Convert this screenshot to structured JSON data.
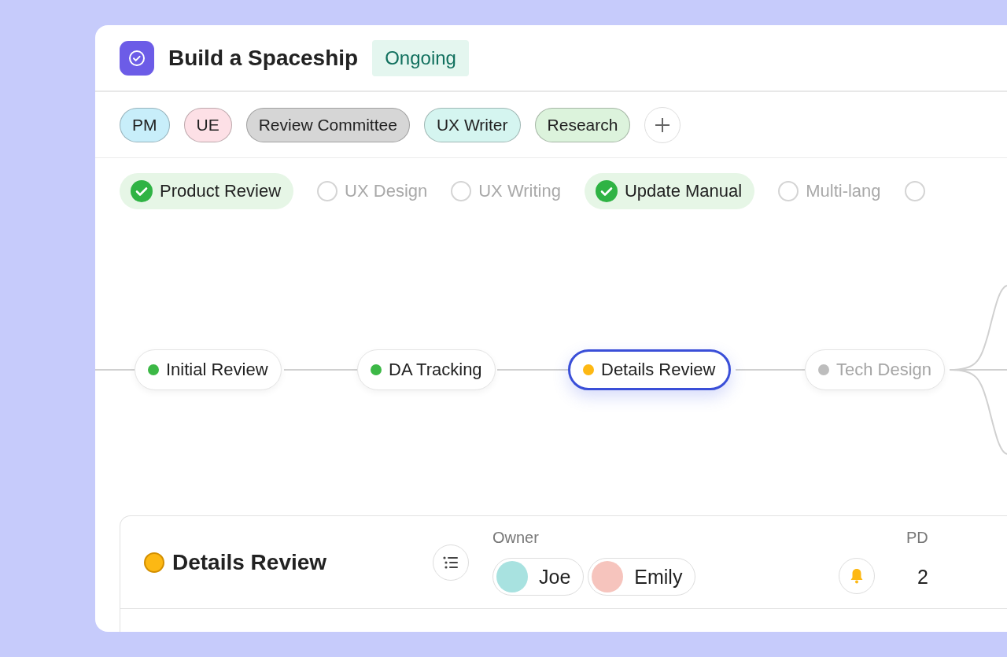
{
  "project": {
    "title": "Build a Spaceship",
    "status": "Ongoing"
  },
  "roles": [
    {
      "label": "PM",
      "color": "#c8eefa"
    },
    {
      "label": "UE",
      "color": "#fde0e6"
    },
    {
      "label": "Review Committee",
      "color": "#d6d6d6"
    },
    {
      "label": "UX Writer",
      "color": "#d5f5f0"
    },
    {
      "label": "Research",
      "color": "#dcf3dc"
    }
  ],
  "steps": [
    {
      "label": "Product Review",
      "checked": true
    },
    {
      "label": "UX Design",
      "checked": false
    },
    {
      "label": "UX Writing",
      "checked": false
    },
    {
      "label": "Update Manual",
      "checked": true
    },
    {
      "label": "Multi-lang",
      "checked": false
    },
    {
      "checked": false
    }
  ],
  "flow": [
    {
      "label": "Initial Review",
      "color": "#3cb846",
      "selected": false,
      "disabled": false
    },
    {
      "label": "DA Tracking",
      "color": "#3cb846",
      "selected": false,
      "disabled": false
    },
    {
      "label": "Details Review",
      "color": "#fdb813",
      "selected": true,
      "disabled": false
    },
    {
      "label": "Tech Design",
      "color": "#bdbdbd",
      "selected": false,
      "disabled": true
    }
  ],
  "detail": {
    "title": "Details Review",
    "color": "#fdb813",
    "owner_label": "Owner",
    "owners": [
      {
        "name": "Joe",
        "color": "#a8e2e0"
      },
      {
        "name": "Emily",
        "color": "#f6c4bd"
      }
    ],
    "pd_label": "PD",
    "pd_value": "2"
  }
}
